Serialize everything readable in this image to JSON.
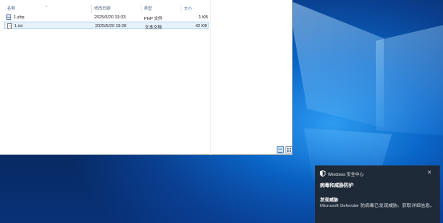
{
  "explorer": {
    "columns": {
      "name": "名称",
      "date": "修改日期",
      "type": "类型",
      "size": "大小"
    },
    "files": [
      {
        "name": "1.php",
        "date": "2025/5/20 19:33",
        "type": "PHP 文件",
        "size": "1 KB",
        "icon": "php-file-icon"
      },
      {
        "name": "1.txt",
        "date": "2025/5/20 19:28",
        "type": "文本文档",
        "size": "42 KB",
        "icon": "text-file-icon"
      }
    ]
  },
  "notification": {
    "app": "Windows 安全中心",
    "title": "病毒和威胁防护",
    "subtitle": "发现威胁",
    "body": "Microsoft Defender 防病毒已发现威胁。获取详细信息。",
    "close_icon": "close-icon",
    "app_icon": "shield-icon"
  },
  "colors": {
    "toast_bg": "#1f2a38",
    "desktop_accent": "#0a67c9",
    "selection": "#e8f2fc"
  }
}
